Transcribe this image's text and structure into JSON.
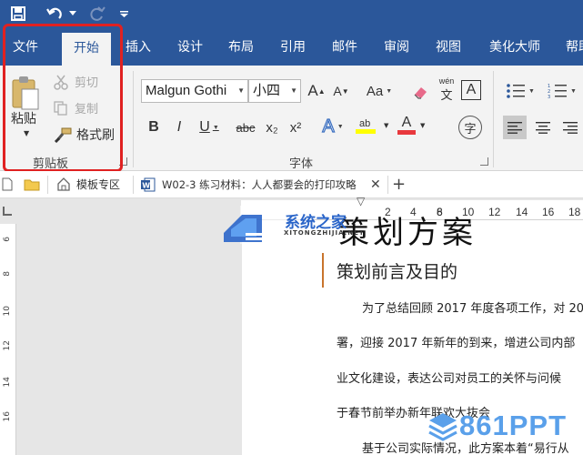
{
  "quick_access": {
    "save_icon": "save-icon",
    "undo_icon": "undo-icon",
    "redo_icon": "redo-icon",
    "customize_icon": "customize-quick-access-icon"
  },
  "ribbon_tabs": [
    {
      "label": "文件",
      "active": false
    },
    {
      "label": "开始",
      "active": true
    },
    {
      "label": "插入",
      "active": false
    },
    {
      "label": "设计",
      "active": false
    },
    {
      "label": "布局",
      "active": false
    },
    {
      "label": "引用",
      "active": false
    },
    {
      "label": "邮件",
      "active": false
    },
    {
      "label": "审阅",
      "active": false
    },
    {
      "label": "视图",
      "active": false
    },
    {
      "label": "美化大师",
      "active": false
    },
    {
      "label": "帮助",
      "active": false
    }
  ],
  "clipboard": {
    "group_label": "剪贴板",
    "paste_label": "粘贴",
    "cut_label": "剪切",
    "copy_label": "复制",
    "format_painter_label": "格式刷"
  },
  "font": {
    "group_label": "字体",
    "font_name": "Malgun Gothi",
    "font_size": "小四",
    "grow_label": "A",
    "shrink_label": "A",
    "case_label": "Aa",
    "phonetic_label": "wén",
    "border_label": "A",
    "bold_label": "B",
    "italic_label": "I",
    "underline_label": "U",
    "strike_label": "abc",
    "subscript_label": "x₂",
    "superscript_label": "x²",
    "effects_label": "A",
    "highlight_label": "ab",
    "font_color_label": "A",
    "enclose_label": "字"
  },
  "colors": {
    "accent": "#2b579a",
    "highlight": "#ffff00",
    "font_color": "#e8383d",
    "annotation": "#e02121"
  },
  "doc_tabs": {
    "template_label": "模板专区",
    "document_label": "W02-3 练习材料：人人都要会的打印攻略"
  },
  "ruler": {
    "h_marks": [
      "2",
      "4",
      "6",
      "8",
      "10",
      "12",
      "14",
      "16",
      "18"
    ],
    "v_marks": [
      "6",
      "8",
      "10",
      "12",
      "14",
      "16"
    ]
  },
  "document": {
    "heading": "策划方案",
    "subheading": "策划前言及目的",
    "paragraphs": [
      "为了总结回顾 2017 年度各项工作，对 20",
      "署，迎接 2017 年新年的到来，增进公司内部",
      "业文化建设，表达公司对员工的关怀与问候",
      "于春节前举办新年联欢大抜会",
      "基于公司实际情况，此方案本着“易行从"
    ]
  },
  "watermarks": {
    "site1_name": "系统之家",
    "site1_url": "XITONGZHIJIA.NET",
    "site2_name": "861PPT"
  }
}
